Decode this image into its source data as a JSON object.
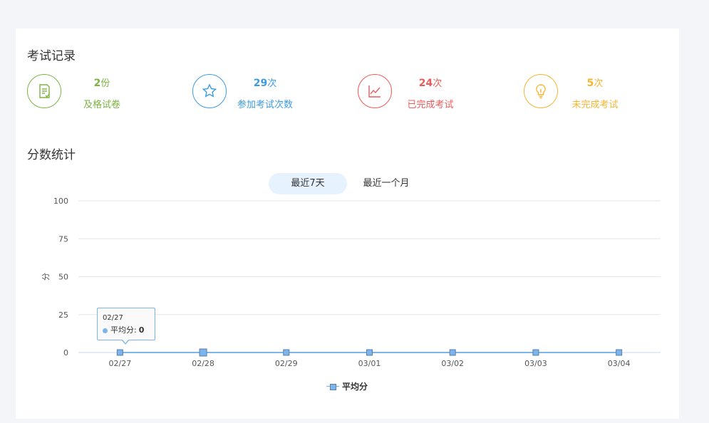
{
  "exam_records": {
    "title": "考试记录",
    "stats": [
      {
        "value": "2",
        "unit": "份",
        "label": "及格试卷",
        "color": "#7cb342",
        "icon": "document-icon"
      },
      {
        "value": "29",
        "unit": "次",
        "label": "参加考试次数",
        "color": "#3d9be0",
        "icon": "star-icon"
      },
      {
        "value": "24",
        "unit": "次",
        "label": "已完成考试",
        "color": "#ec5b5b",
        "icon": "line-chart-icon"
      },
      {
        "value": "5",
        "unit": "次",
        "label": "未完成考试",
        "color": "#f5b533",
        "icon": "lightbulb-icon"
      }
    ]
  },
  "score_stats": {
    "title": "分数统计",
    "tabs": [
      {
        "label": "最近7天",
        "active": true
      },
      {
        "label": "最近一个月",
        "active": false
      }
    ]
  },
  "tooltip": {
    "date": "02/27",
    "series": "平均分",
    "value": "0"
  },
  "chart_data": {
    "type": "line",
    "categories": [
      "02/27",
      "02/28",
      "02/29",
      "03/01",
      "03/02",
      "03/03",
      "03/04"
    ],
    "series": [
      {
        "name": "平均分",
        "values": [
          0,
          0,
          0,
          0,
          0,
          0,
          0
        ],
        "color": "#7cb5ec"
      }
    ],
    "ylabel": "分",
    "ylim": [
      0,
      100
    ],
    "yticks": [
      0,
      25,
      50,
      75,
      100
    ],
    "grid": true,
    "legend": "bottom-center"
  }
}
